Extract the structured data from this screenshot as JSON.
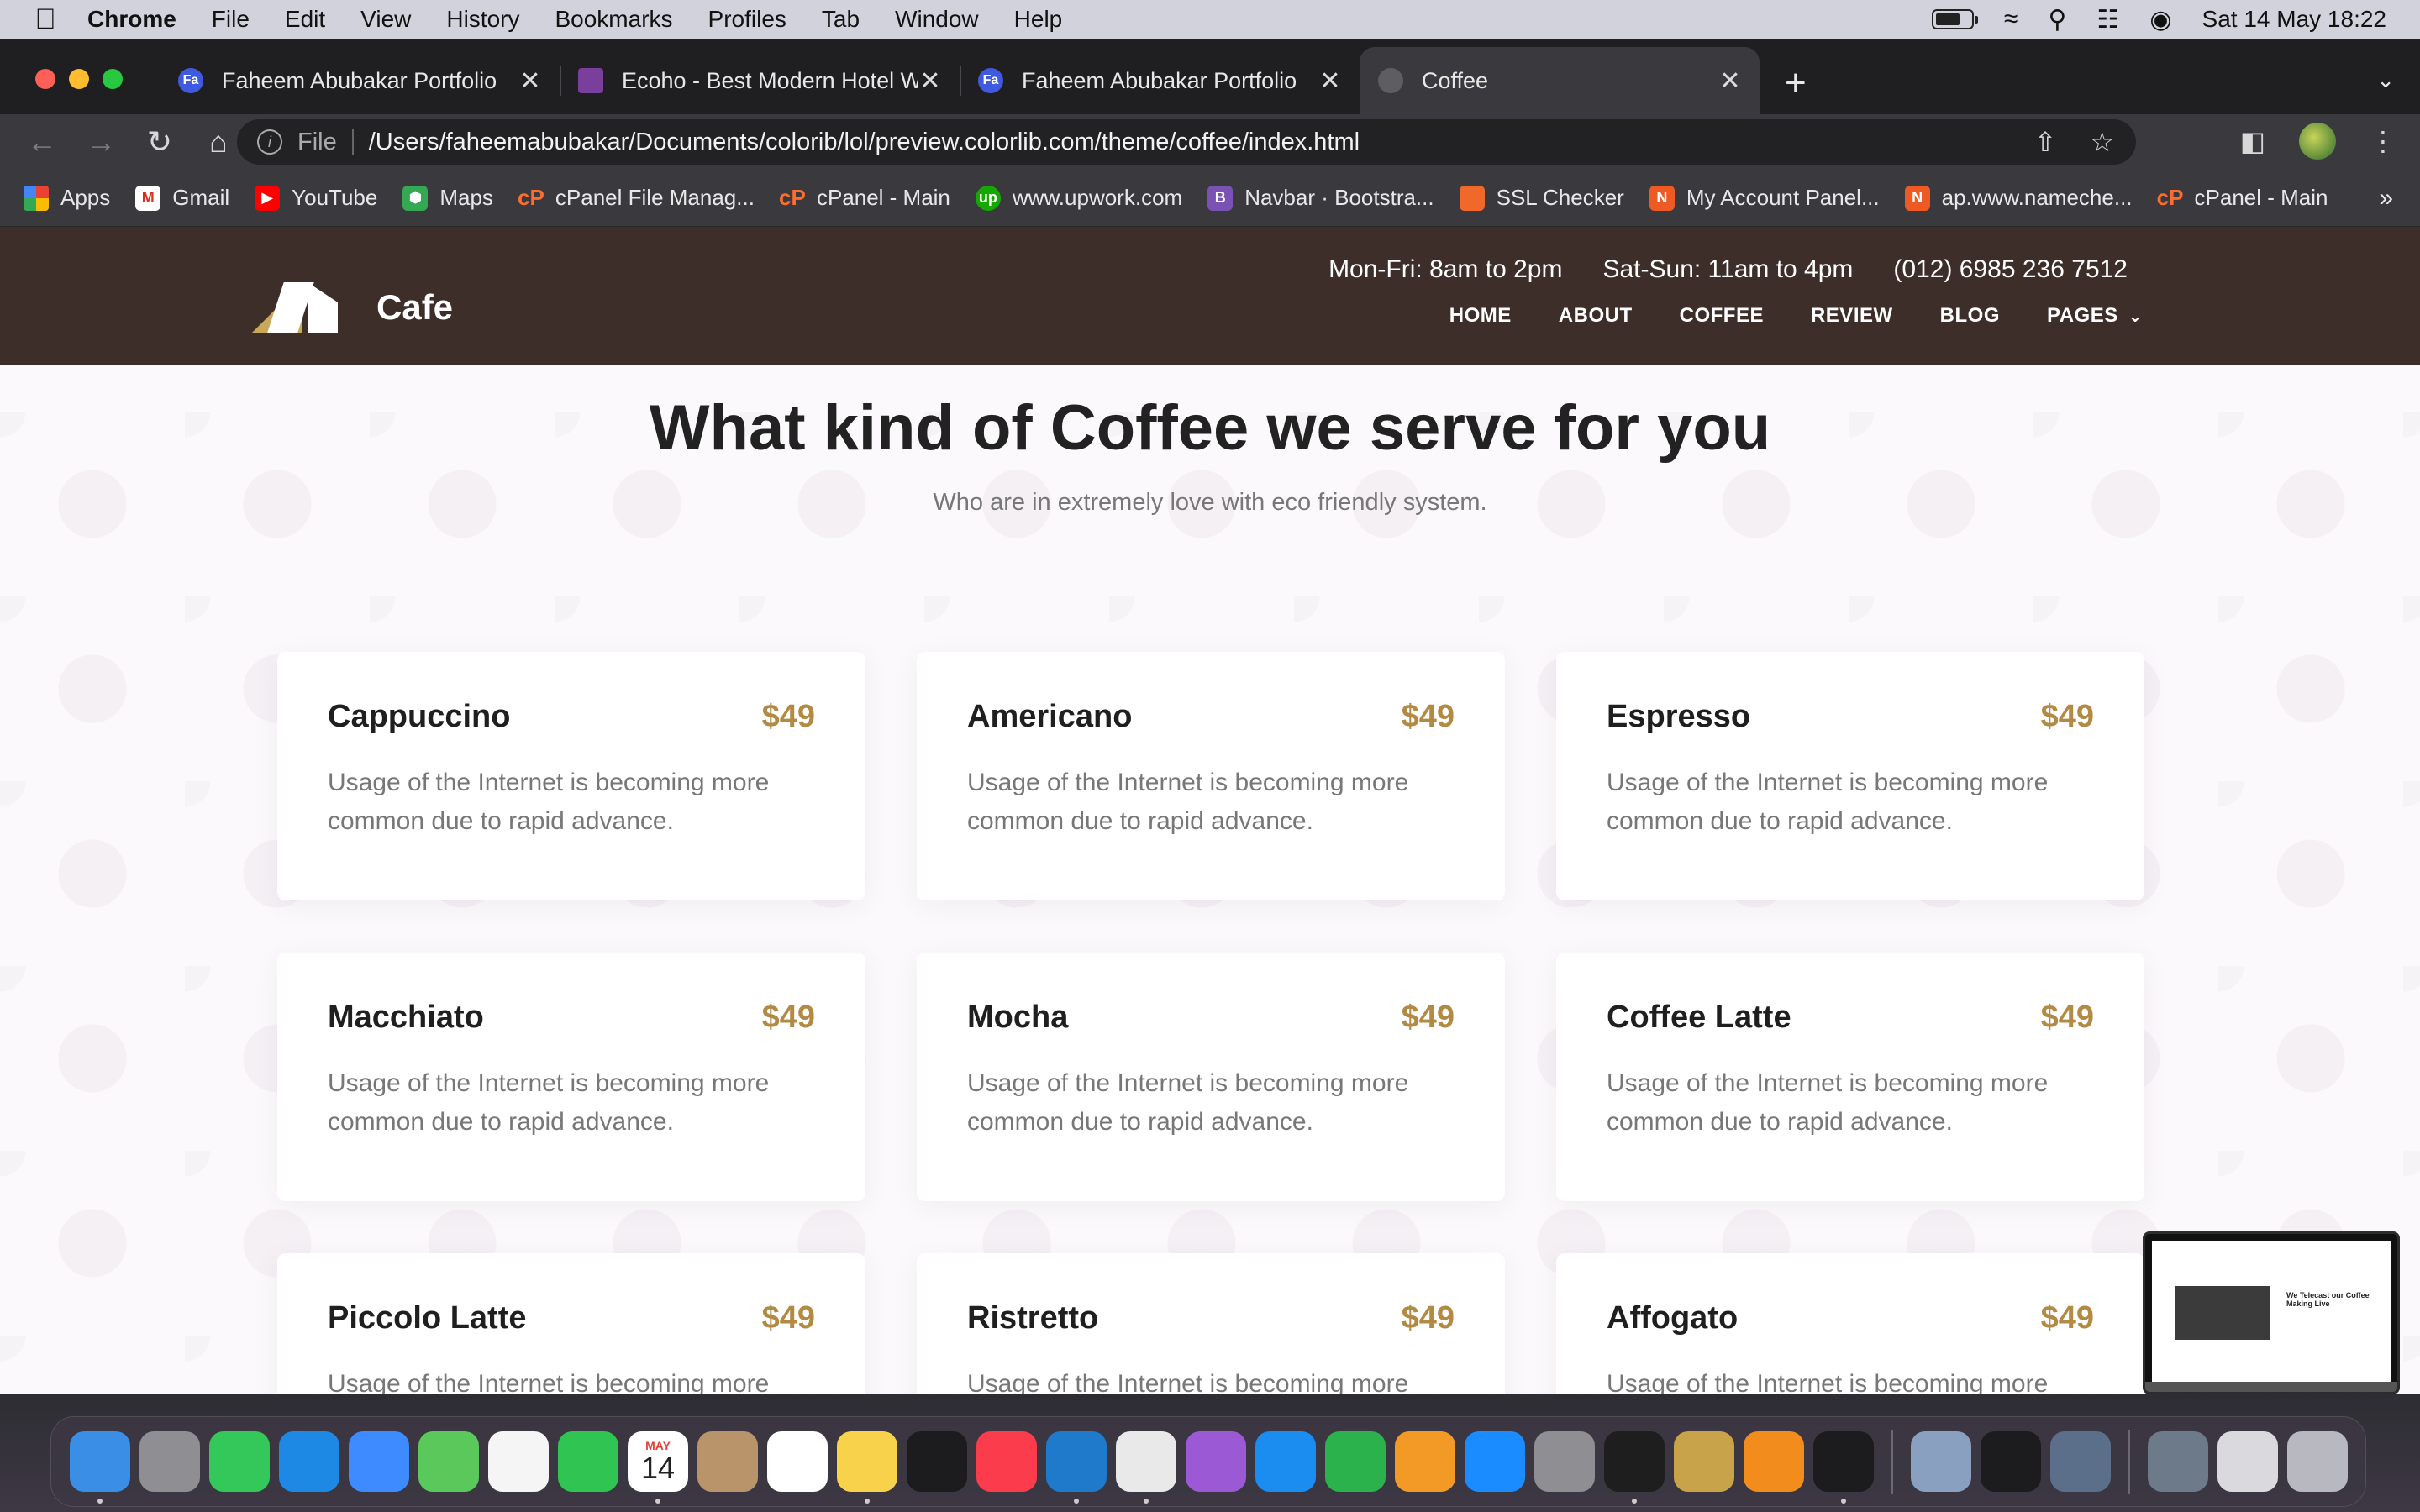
{
  "menubar": {
    "app_name": "Chrome",
    "items": [
      "File",
      "Edit",
      "View",
      "History",
      "Bookmarks",
      "Profiles",
      "Tab",
      "Window",
      "Help"
    ],
    "datetime": "Sat 14 May  18:22"
  },
  "tabs": [
    {
      "title": "Faheem Abubakar Portfolio",
      "favicon_text": "Fa",
      "active": false
    },
    {
      "title": "Ecoho - Best Modern Hotel We",
      "favicon_text": "",
      "active": false
    },
    {
      "title": "Faheem Abubakar Portfolio",
      "favicon_text": "Fa",
      "active": false
    },
    {
      "title": "Coffee",
      "favicon_text": "",
      "active": true
    }
  ],
  "toolbar": {
    "scheme": "File",
    "url": "/Users/faheemabubakar/Documents/colorib/lol/preview.colorlib.com/theme/coffee/index.html"
  },
  "bookmarks": [
    {
      "label": "Apps",
      "icon": "apps-grid-icon"
    },
    {
      "label": "Gmail",
      "icon": "gmail-icon",
      "glyph": "M"
    },
    {
      "label": "YouTube",
      "icon": "youtube-icon",
      "glyph": "▶"
    },
    {
      "label": "Maps",
      "icon": "maps-icon",
      "glyph": "⬢"
    },
    {
      "label": "cPanel File Manag...",
      "icon": "cpanel-icon",
      "glyph": "cP"
    },
    {
      "label": "cPanel - Main",
      "icon": "cpanel-icon",
      "glyph": "cP"
    },
    {
      "label": "www.upwork.com",
      "icon": "upwork-icon",
      "glyph": "up"
    },
    {
      "label": "Navbar · Bootstra...",
      "icon": "bootstrap-icon",
      "glyph": "B"
    },
    {
      "label": "SSL Checker",
      "icon": "lock-icon",
      "glyph": "🔒"
    },
    {
      "label": "My Account Panel...",
      "icon": "namecheap-icon",
      "glyph": "N"
    },
    {
      "label": "ap.www.nameche...",
      "icon": "namecheap-icon",
      "glyph": "N"
    },
    {
      "label": "cPanel - Main",
      "icon": "cpanel-icon",
      "glyph": "cP"
    }
  ],
  "site": {
    "logo_text": "Cafe",
    "hours_weekday": "Mon-Fri: 8am to 2pm",
    "hours_weekend": "Sat-Sun: 11am to 4pm",
    "phone": "(012) 6985 236 7512",
    "nav": [
      "HOME",
      "ABOUT",
      "COFFEE",
      "REVIEW",
      "BLOG",
      "PAGES"
    ],
    "section_title": "What kind of Coffee we serve for you",
    "section_subtitle": "Who are in extremely love with eco friendly system.",
    "menu": [
      {
        "name": "Cappuccino",
        "price": "$49",
        "desc": "Usage of the Internet is becoming more common due to rapid advance."
      },
      {
        "name": "Americano",
        "price": "$49",
        "desc": "Usage of the Internet is becoming more common due to rapid advance."
      },
      {
        "name": "Espresso",
        "price": "$49",
        "desc": "Usage of the Internet is becoming more common due to rapid advance."
      },
      {
        "name": "Macchiato",
        "price": "$49",
        "desc": "Usage of the Internet is becoming more common due to rapid advance."
      },
      {
        "name": "Mocha",
        "price": "$49",
        "desc": "Usage of the Internet is becoming more common due to rapid advance."
      },
      {
        "name": "Coffee Latte",
        "price": "$49",
        "desc": "Usage of the Internet is becoming more common due to rapid advance."
      },
      {
        "name": "Piccolo Latte",
        "price": "$49",
        "desc": "Usage of the Internet is becoming more common due to rapid advance."
      },
      {
        "name": "Ristretto",
        "price": "$49",
        "desc": "Usage of the Internet is becoming more common due to rapid advance."
      },
      {
        "name": "Affogato",
        "price": "$49",
        "desc": "Usage of the Internet is becoming more common due to rapid advance."
      }
    ]
  },
  "pip": {
    "text": "We Telecast our Coffee Making Live"
  },
  "dock": {
    "calendar_month": "MAY",
    "calendar_day": "14",
    "apps": [
      {
        "name": "finder-icon",
        "color": "#3a8ee6"
      },
      {
        "name": "launchpad-icon",
        "color": "#8e8e93"
      },
      {
        "name": "messages-icon",
        "color": "#34c759"
      },
      {
        "name": "safari-icon",
        "color": "#1e88e5"
      },
      {
        "name": "mail-icon",
        "color": "#3d8bff"
      },
      {
        "name": "maps-app-icon",
        "color": "#5ac85a"
      },
      {
        "name": "photos-icon",
        "color": "#f5f5f5"
      },
      {
        "name": "facetime-icon",
        "color": "#30c452"
      },
      {
        "name": "calendar-icon",
        "color": "#ffffff"
      },
      {
        "name": "contacts-icon",
        "color": "#b9936a"
      },
      {
        "name": "reminders-icon",
        "color": "#ffffff"
      },
      {
        "name": "notes-icon",
        "color": "#f7d24a"
      },
      {
        "name": "tv-icon",
        "color": "#1c1c1e"
      },
      {
        "name": "music-icon",
        "color": "#fa3c4c"
      },
      {
        "name": "vscode-icon",
        "color": "#1f7acc"
      },
      {
        "name": "chrome-icon",
        "color": "#e9e9e9"
      },
      {
        "name": "podcasts-icon",
        "color": "#9b59d6"
      },
      {
        "name": "keynote-icon",
        "color": "#1b8cf0"
      },
      {
        "name": "numbers-icon",
        "color": "#2bb24c"
      },
      {
        "name": "pages-icon",
        "color": "#f39a26"
      },
      {
        "name": "app-store-icon",
        "color": "#1a8cff"
      },
      {
        "name": "system-preferences-icon",
        "color": "#8e8e93"
      },
      {
        "name": "figma-icon",
        "color": "#1e1e1e"
      },
      {
        "name": "archive-utility-icon",
        "color": "#c9a34a"
      },
      {
        "name": "vlc-icon",
        "color": "#f28c1c"
      },
      {
        "name": "terminal-icon",
        "color": "#1c1c1e"
      },
      {
        "name": "preview-icon",
        "color": "#8aa0c0"
      },
      {
        "name": "activity-monitor-icon",
        "color": "#1c1c1e"
      },
      {
        "name": "quicktime-icon",
        "color": "#5b6f8a"
      },
      {
        "name": "downloads-stack-icon",
        "color": "#6d7a8a"
      },
      {
        "name": "screenshot-stack-icon",
        "color": "#d9d9de"
      },
      {
        "name": "trash-icon",
        "color": "#b8b8c0"
      }
    ]
  }
}
